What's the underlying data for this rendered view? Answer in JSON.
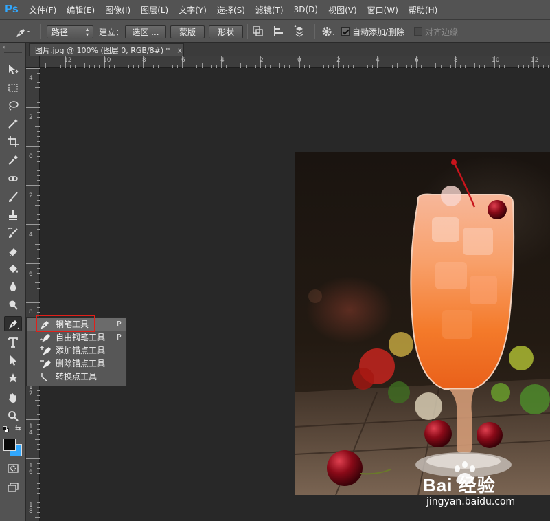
{
  "app": {
    "logo": "Ps",
    "menus": [
      "文件(F)",
      "编辑(E)",
      "图像(I)",
      "图层(L)",
      "文字(Y)",
      "选择(S)",
      "滤镜(T)",
      "3D(D)",
      "视图(V)",
      "窗口(W)",
      "帮助(H)"
    ]
  },
  "options": {
    "mode_select": "路径",
    "make_label": "建立：",
    "selection_button": "选区 ...",
    "mask_button": "蒙版",
    "shape_button": "形状",
    "auto_add_delete_label": "自动添加/删除",
    "auto_add_delete_checked": true,
    "align_edges_label": "对齐边缘",
    "align_edges_checked": false
  },
  "document": {
    "tab_title": "图片.jpg @ 100% (图层 0, RGB/8#) *",
    "tab_close": "×"
  },
  "ruler": {
    "top_labels": [
      "12",
      "10",
      "8",
      "6",
      "4",
      "2",
      "0",
      "2",
      "4",
      "6",
      "8",
      "10",
      "12"
    ],
    "left_labels": [
      "4",
      "2",
      "0",
      "2",
      "4",
      "6",
      "8",
      "1 0",
      "1 2",
      "1 4",
      "1 6",
      "1 8"
    ]
  },
  "flyout": {
    "items": [
      {
        "label": "钢笔工具",
        "key": "P",
        "icon": "pen-icon",
        "selected": true
      },
      {
        "label": "自由钢笔工具",
        "key": "P",
        "icon": "freeform-pen-icon",
        "selected": false
      },
      {
        "label": "添加锚点工具",
        "key": "",
        "icon": "add-anchor-point-icon",
        "selected": false
      },
      {
        "label": "删除锚点工具",
        "key": "",
        "icon": "delete-anchor-point-icon",
        "selected": false
      },
      {
        "label": "转换点工具",
        "key": "",
        "icon": "convert-point-icon",
        "selected": false
      }
    ]
  },
  "watermark": {
    "brand": "Bai 经验",
    "url": "jingyan.baidu.com"
  },
  "colors": {
    "ps_blue": "#31a8ff",
    "chrome": "#535353",
    "canvas_bg": "#282828",
    "highlight_red": "#e0201a"
  }
}
